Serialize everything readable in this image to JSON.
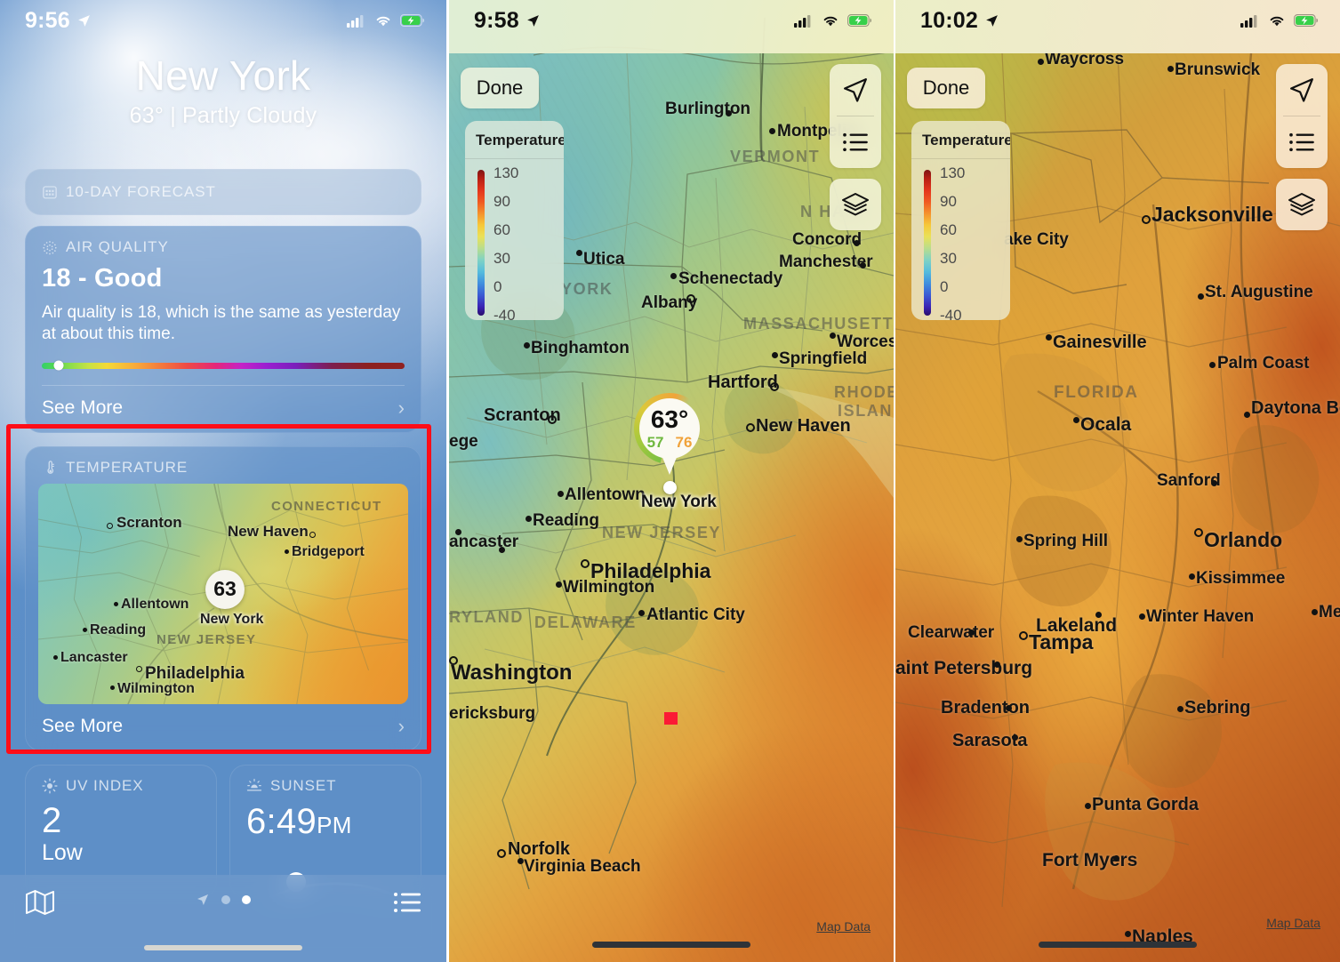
{
  "panel1": {
    "status": {
      "time": "9:56",
      "location_icon": "location-arrow-icon",
      "cellular_icon": "cellular-bars-icon",
      "wifi_icon": "wifi-icon",
      "battery_icon": "battery-charging-icon"
    },
    "city": "New York",
    "conditions": "63° | Partly Cloudy",
    "forecast_card": {
      "icon": "calendar-icon",
      "label": "10-DAY FORECAST"
    },
    "air_quality": {
      "icon": "air-quality-icon",
      "label": "AIR QUALITY",
      "value": "18 - Good",
      "description": "Air quality is 18, which is the same as yesterday at about this time.",
      "see_more": "See More",
      "scale_position_percent": 4.6
    },
    "temperature_card": {
      "icon": "thermometer-icon",
      "label": "TEMPERATURE",
      "see_more": "See More",
      "pin_value": "63",
      "pin_city": "New York",
      "cities": [
        "Scranton",
        "New Haven",
        "Bridgeport",
        "Allentown",
        "Reading",
        "Lancaster",
        "Philadelphia",
        "Wilmington"
      ],
      "states": [
        "CONNECTICUT",
        "NEW JERSEY"
      ]
    },
    "uv_index": {
      "icon": "sun-icon",
      "label": "UV INDEX",
      "value": "2",
      "level": "Low"
    },
    "sunset": {
      "icon": "sunset-icon",
      "label": "SUNSET",
      "time": "6:49",
      "ampm": "PM"
    },
    "tabbar": {
      "map_icon": "map-icon",
      "location_icon": "location-arrow-icon",
      "list_icon": "list-icon",
      "pages": 2,
      "active_page": 2
    }
  },
  "panel2": {
    "status": {
      "time": "9:58",
      "location_icon": "location-arrow-icon",
      "cellular_icon": "cellular-bars-icon",
      "wifi_icon": "wifi-icon",
      "battery_icon": "battery-charging-icon"
    },
    "done_label": "Done",
    "legend": {
      "title": "Temperature",
      "ticks": [
        "130",
        "90",
        "60",
        "30",
        "0",
        "-40"
      ]
    },
    "controls": {
      "locate_icon": "location-arrow-icon",
      "list_icon": "list-icon",
      "layers_icon": "layers-icon"
    },
    "pin": {
      "temp": "63°",
      "low": "57",
      "high": "76",
      "label": "New York"
    },
    "map_data_link": "Map Data",
    "cities": [
      "Burlington",
      "Montpelier",
      "Concord",
      "Manchester",
      "Utica",
      "Schenectady",
      "Albany",
      "Worcester",
      "Springfield",
      "Hartford",
      "New Haven",
      "Binghamton",
      "Scranton",
      "Allentown",
      "Reading",
      "Lancaster",
      "Philadelphia",
      "Wilmington",
      "Atlantic City",
      "Washington",
      "Fredericksburg",
      "Norfolk",
      "Virginia Beach"
    ],
    "states": [
      "VERMONT",
      "N HAMP",
      "MASSACHUSETTS",
      "RHODE ISLAND",
      "YORK",
      "NEW JERSEY",
      "MARYLAND",
      "DELAWARE"
    ]
  },
  "panel3": {
    "status": {
      "time": "10:02",
      "location_icon": "location-arrow-icon",
      "cellular_icon": "cellular-bars-icon",
      "wifi_icon": "wifi-icon",
      "battery_icon": "battery-charging-icon"
    },
    "done_label": "Done",
    "legend": {
      "title": "Temperature",
      "ticks": [
        "130",
        "90",
        "60",
        "30",
        "0",
        "-40"
      ]
    },
    "controls": {
      "locate_icon": "location-arrow-icon",
      "list_icon": "list-icon",
      "layers_icon": "layers-icon"
    },
    "map_data_link": "Map Data",
    "cities": [
      "Waycross",
      "Brunswick",
      "Jacksonville",
      "Lake City",
      "St. Augustine",
      "Gainesville",
      "Palm Coast",
      "Daytona Beach",
      "Ocala",
      "Sanford",
      "Orlando",
      "Spring Hill",
      "Kissimmee",
      "Winter Haven",
      "Melb",
      "Lakeland",
      "Clearwater",
      "Tampa",
      "Saint Petersburg",
      "Bradenton",
      "Sebring",
      "Sarasota",
      "Punta Gorda",
      "Fort Myers",
      "Naples"
    ],
    "states": [
      "FLORIDA"
    ]
  },
  "colors": {
    "annotation_box": "#ff0d18",
    "red_marker": "#fb1a35",
    "aq_good": "#35d06a",
    "pin_low": "#6fb83f",
    "pin_high": "#f0a23a"
  }
}
